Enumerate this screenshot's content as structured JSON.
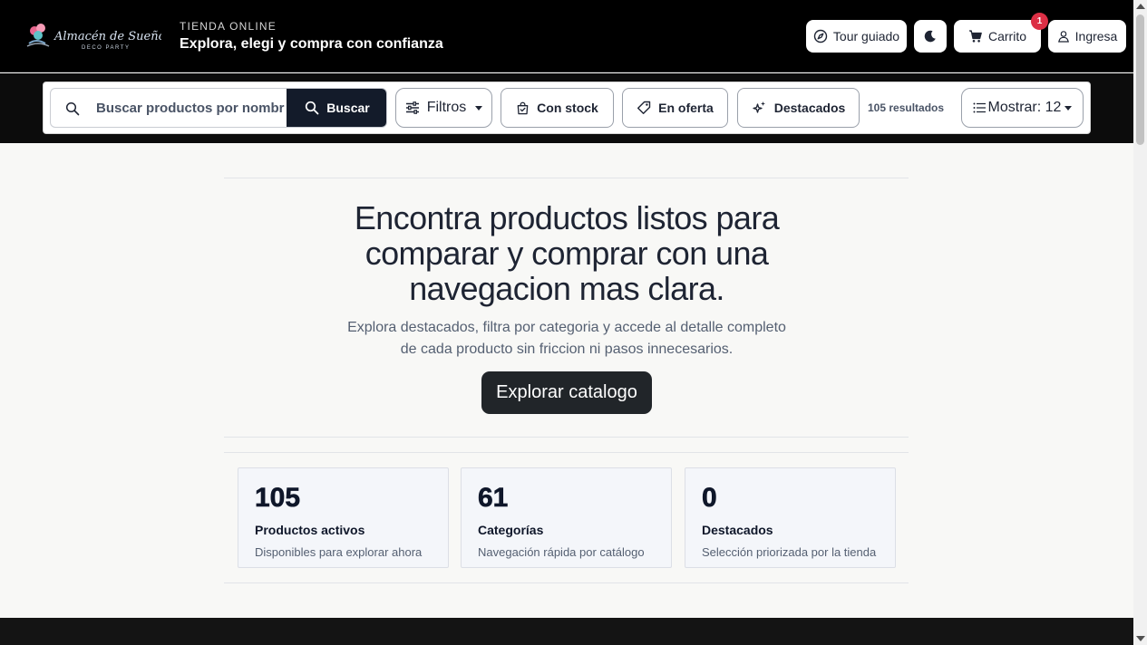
{
  "header": {
    "logo_text": "Almacén de Sueños",
    "logo_subtext": "DECO PARTY",
    "kicker": "TIENDA ONLINE",
    "tagline": "Explora, elegi y compra con confianza",
    "tour_label": "Tour guiado",
    "cart_label": "Carrito",
    "cart_count": "1",
    "login_label": "Ingresa"
  },
  "toolbar": {
    "search_placeholder": "Buscar productos por nombre",
    "search_button": "Buscar",
    "filters_label": "Filtros",
    "stock_label": "Con stock",
    "offer_label": "En oferta",
    "featured_label": "Destacados",
    "results": "105 resultados",
    "show_label": "Mostrar: 12"
  },
  "hero": {
    "title": "Encontra productos listos para comparar y comprar con una navegacion mas clara.",
    "subtitle": "Explora destacados, filtra por categoria y accede al detalle completo de cada producto sin friccion ni pasos innecesarios.",
    "cta": "Explorar catalogo"
  },
  "stats": [
    {
      "value": "105",
      "label": "Productos activos",
      "desc": "Disponibles para explorar ahora"
    },
    {
      "value": "61",
      "label": "Categorías",
      "desc": "Navegación rápida por catálogo"
    },
    {
      "value": "0",
      "label": "Destacados",
      "desc": "Selección priorizada por la tienda"
    }
  ],
  "colors": {
    "header_bg": "#000000",
    "accent_dark": "#131b2a",
    "badge": "#dc2f45",
    "page_bg": "#f8f8f6"
  }
}
